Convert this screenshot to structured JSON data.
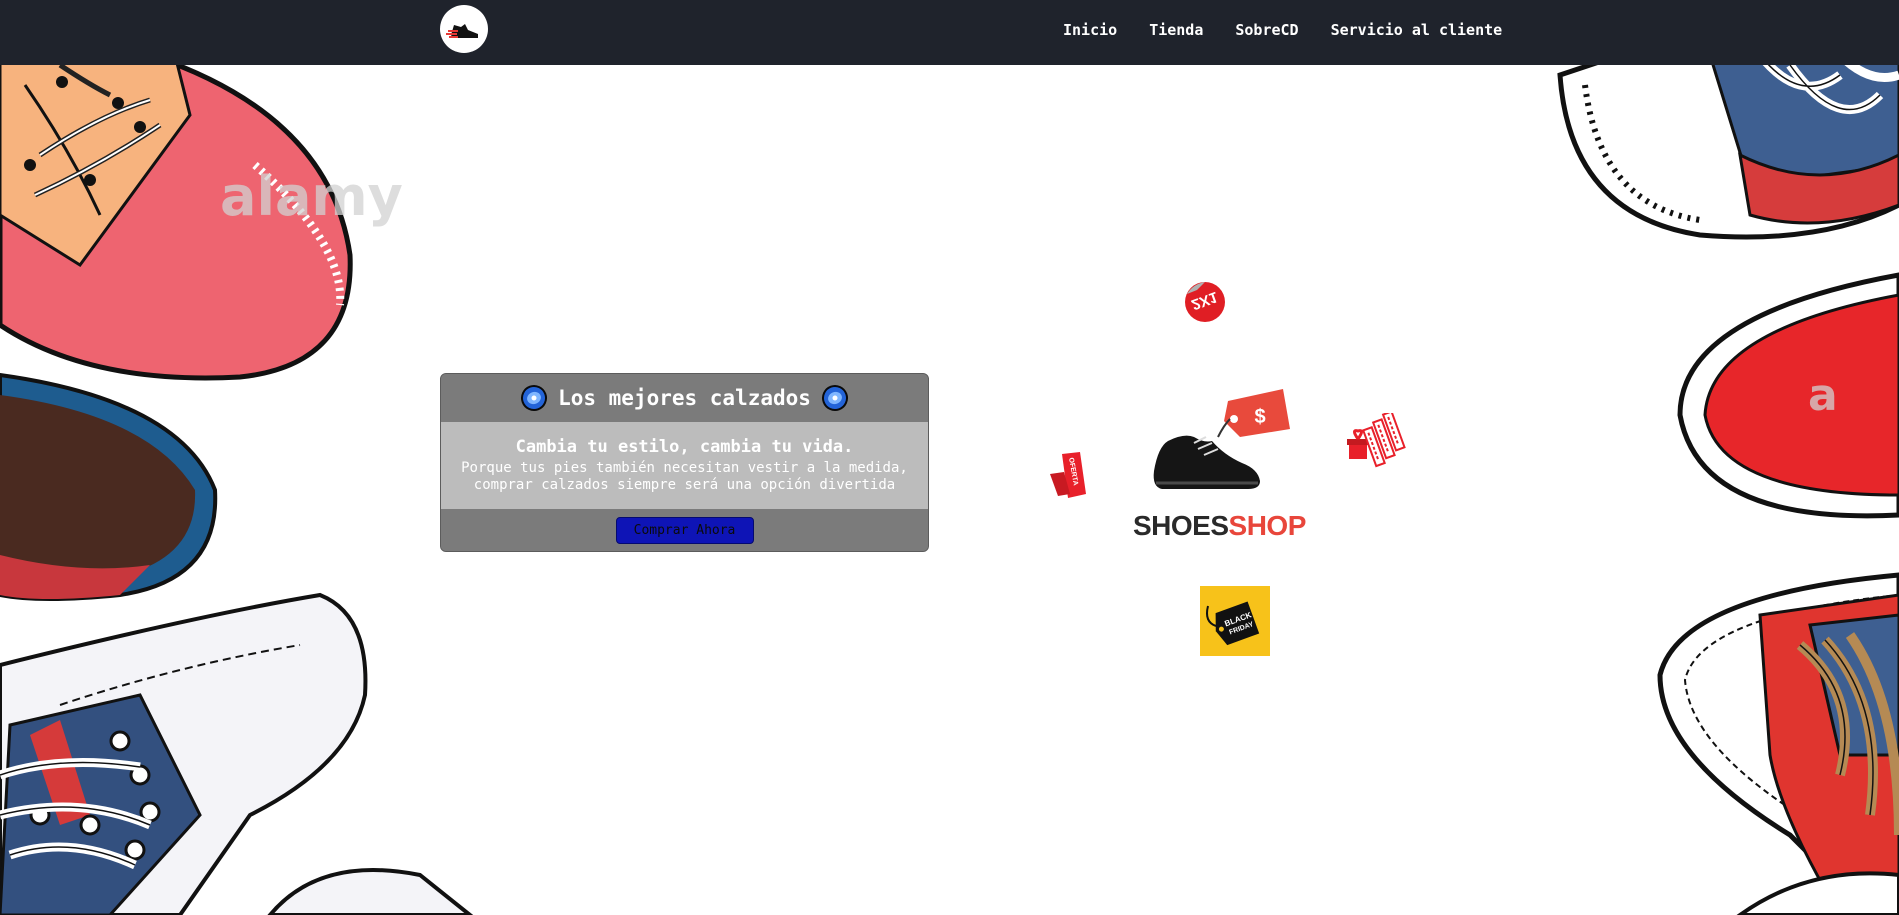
{
  "nav": {
    "links": [
      "Inicio",
      "Tienda",
      "SobreCD",
      "Servicio al cliente"
    ]
  },
  "hero": {
    "title": "Los mejores calzados",
    "subtitle": "Cambia tu estilo, cambia tu vida.",
    "line1": "Porque tus pies también necesitan vestir a la medida,",
    "line2": "comprar calzados siempre será una opción divertida",
    "button": "Comprar Ahora"
  },
  "promo": {
    "brand_part1": "SHOES",
    "brand_part2": "SHOP",
    "badge_2x1": "2X1",
    "tag_oferta": "OFERTA",
    "tag_black_friday": [
      "BLACK",
      "FRIDAY"
    ],
    "dollar_sign": "$"
  },
  "watermark": "alamy",
  "colors": {
    "navbar": "#1f232c",
    "button": "#0e14b6",
    "brand_red": "#e8463b"
  }
}
